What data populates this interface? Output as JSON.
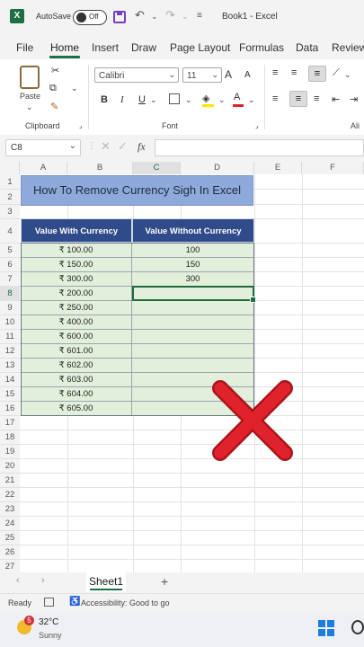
{
  "titlebar": {
    "autosave_label": "AutoSave",
    "autosave_state": "Off",
    "book_title": "Book1  -  Excel"
  },
  "tabs": [
    "File",
    "Home",
    "Insert",
    "Draw",
    "Page Layout",
    "Formulas",
    "Data",
    "Review"
  ],
  "active_tab": "Home",
  "ribbon": {
    "paste_label": "Paste",
    "clipboard_label": "Clipboard",
    "font_name": "Calibri",
    "font_size": "11",
    "font_group_label": "Font",
    "align_group_label": "Ali",
    "bold": "B",
    "italic": "I",
    "underline": "U",
    "grow_font": "A",
    "shrink_font": "A"
  },
  "formula_bar": {
    "name_box": "C8",
    "fx_label": "fx",
    "formula": ""
  },
  "columns": [
    "A",
    "B",
    "C",
    "D",
    "E",
    "F"
  ],
  "rows": [
    "1",
    "2",
    "3",
    "4",
    "5",
    "6",
    "7",
    "8",
    "9",
    "10",
    "11",
    "12",
    "13",
    "14",
    "15",
    "16",
    "17",
    "18",
    "19",
    "20",
    "21",
    "22",
    "23",
    "24",
    "25",
    "26",
    "27"
  ],
  "sheet": {
    "title": "How To Remove Currency Sigh In Excel",
    "header_with": "Value With Currency",
    "header_without": "Value Without Currency",
    "with_currency": [
      "₹ 100.00",
      "₹ 150.00",
      "₹ 300.00",
      "₹ 200.00",
      "₹ 250.00",
      "₹ 400.00",
      "₹ 600.00",
      "₹ 601.00",
      "₹ 602.00",
      "₹ 603.00",
      "₹ 604.00",
      "₹ 605.00"
    ],
    "without_currency": [
      "100",
      "150",
      "300",
      "",
      "",
      "",
      "",
      "",
      "",
      "",
      "",
      ""
    ]
  },
  "sheet_tabs": {
    "active": "Sheet1",
    "add": "+"
  },
  "statusbar": {
    "ready": "Ready",
    "accessibility": "Accessibility: Good to go"
  },
  "taskbar": {
    "badge": "5",
    "temperature": "32°C",
    "condition": "Sunny"
  },
  "colors": {
    "excel_green": "#1d7044",
    "title_fill": "#8eaadb",
    "header_fill": "#2f4b8a",
    "data_fill": "#e2efda",
    "cross": "#e0222b"
  },
  "icons": [
    "excel-logo-icon",
    "save-icon",
    "undo-icon",
    "redo-icon",
    "customize-icon",
    "paste-icon",
    "cut-icon",
    "copy-icon",
    "format-painter-icon",
    "bold-icon",
    "italic-icon",
    "underline-icon",
    "borders-icon",
    "fill-color-icon",
    "font-color-icon",
    "align-icon",
    "wrap-icon",
    "cancel-icon",
    "enter-icon",
    "red-cross-icon",
    "weather-sun-icon",
    "windows-logo-icon"
  ]
}
